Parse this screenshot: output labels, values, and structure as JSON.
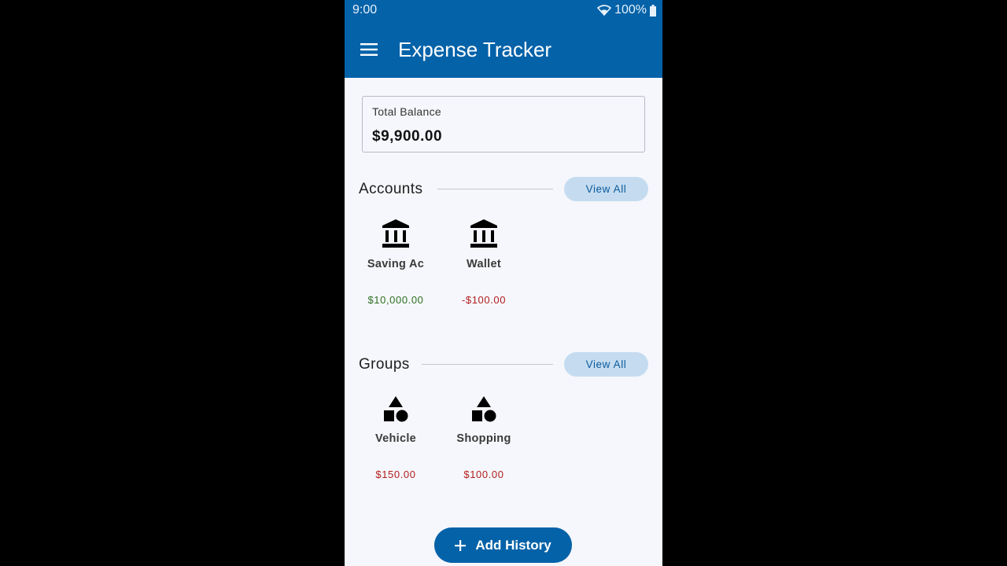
{
  "status": {
    "time": "9:00",
    "battery": "100%"
  },
  "appbar": {
    "title": "Expense Tracker",
    "menu_icon": "hamburger-menu-icon"
  },
  "balance": {
    "label": "Total Balance",
    "value": "$9,900.00"
  },
  "accounts": {
    "title": "Accounts",
    "view_all": "View All",
    "items": [
      {
        "name": "Saving Ac",
        "amount": "$10,000.00",
        "icon": "bank-icon",
        "color": "#2c6e1e"
      },
      {
        "name": "Wallet",
        "amount": "-$100.00",
        "icon": "bank-icon",
        "color": "#b21d1d"
      }
    ]
  },
  "groups": {
    "title": "Groups",
    "view_all": "View All",
    "items": [
      {
        "name": "Vehicle",
        "amount": "$150.00",
        "icon": "shapes-icon",
        "color": "#b21d1d"
      },
      {
        "name": "Shopping",
        "amount": "$100.00",
        "icon": "shapes-icon",
        "color": "#b21d1d"
      }
    ]
  },
  "fab": {
    "label": "Add History",
    "icon": "plus-icon"
  },
  "colors": {
    "primary": "#0462a8",
    "chip_bg": "#c5dcf0",
    "positive": "#2c6e1e",
    "negative": "#b21d1d"
  }
}
